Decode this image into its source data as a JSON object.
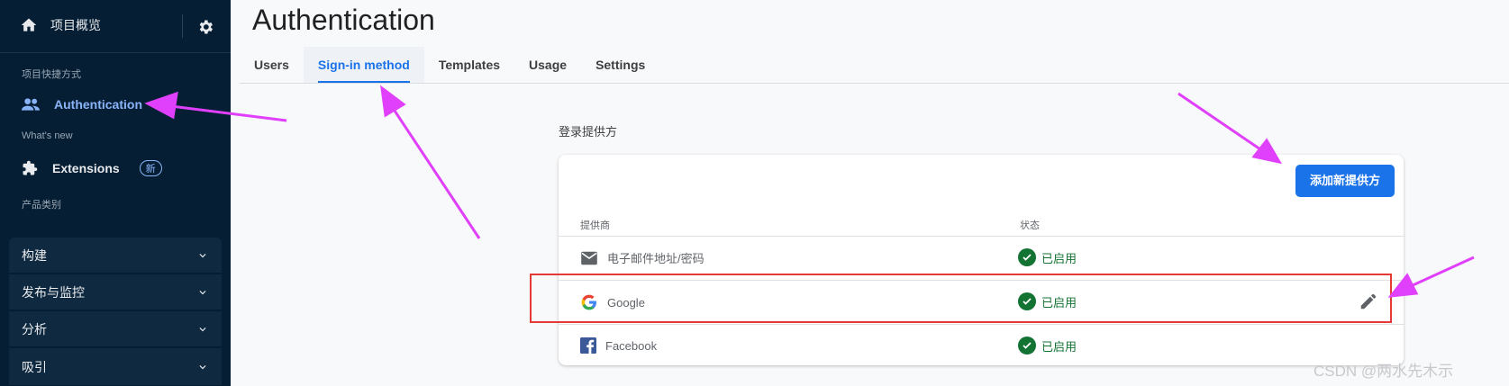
{
  "sidebar": {
    "project_overview": "项目概览",
    "shortcuts_label": "项目快捷方式",
    "authentication": "Authentication",
    "whats_new_label": "What's new",
    "extensions": "Extensions",
    "extensions_badge": "新",
    "product_categories_label": "产品类别",
    "groups": [
      {
        "label": "构建"
      },
      {
        "label": "发布与监控"
      },
      {
        "label": "分析"
      },
      {
        "label": "吸引"
      }
    ]
  },
  "header": {
    "title": "Authentication",
    "tabs": [
      {
        "label": "Users"
      },
      {
        "label": "Sign-in method"
      },
      {
        "label": "Templates"
      },
      {
        "label": "Usage"
      },
      {
        "label": "Settings"
      }
    ]
  },
  "providers": {
    "section_title": "登录提供方",
    "add_button": "添加新提供方",
    "col_provider": "提供商",
    "col_status": "状态",
    "rows": [
      {
        "name": "电子邮件地址/密码",
        "status": "已启用",
        "icon": "email-icon"
      },
      {
        "name": "Google",
        "status": "已启用",
        "icon": "google-icon"
      },
      {
        "name": "Facebook",
        "status": "已启用",
        "icon": "facebook-icon"
      }
    ]
  },
  "watermark": "CSDN @两水先木示",
  "colors": {
    "sidebar_bg": "#051e34",
    "accent": "#1a73e8",
    "status_green": "#137333",
    "annotation_magenta": "#e040fb",
    "highlight_red": "#e53935"
  }
}
